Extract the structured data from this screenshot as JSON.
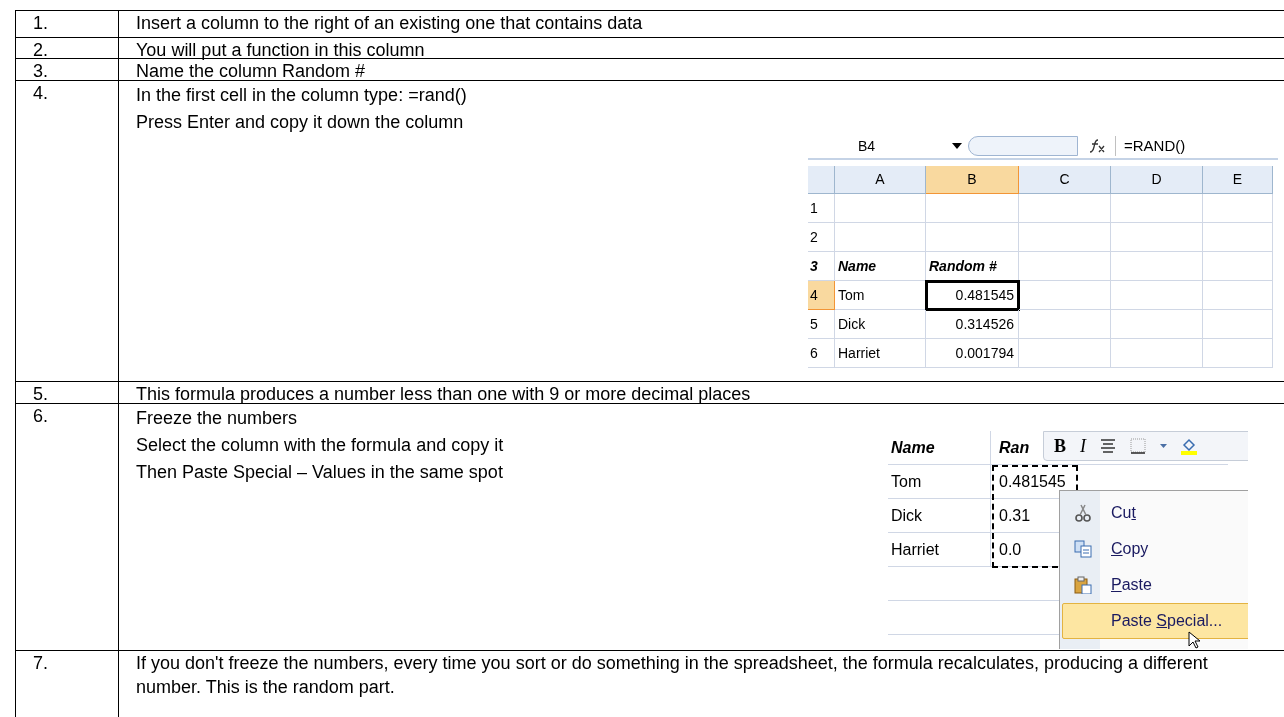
{
  "steps": [
    {
      "number": "1.",
      "lines": [
        "Insert a column to the right of an existing one that contains data"
      ]
    },
    {
      "number": "2.",
      "lines": [
        "You will put a function in this column"
      ]
    },
    {
      "number": "3.",
      "lines": [
        "Name the column Random #"
      ]
    },
    {
      "number": "4.",
      "lines": [
        "In the first cell in the column type: =rand()",
        "Press Enter and copy it down the column"
      ],
      "figure": {
        "kind": "sheet",
        "name_box": "B4",
        "formula": "=RAND()",
        "columns": [
          {
            "label": "A",
            "selected": false
          },
          {
            "label": "B",
            "selected": true
          },
          {
            "label": "C",
            "selected": false
          },
          {
            "label": "D",
            "selected": false
          },
          {
            "label": "E",
            "selected": false
          }
        ],
        "rows": [
          {
            "number": "1",
            "selected": false,
            "kind": "plain",
            "cells": []
          },
          {
            "number": "2",
            "selected": false,
            "kind": "plain",
            "cells": []
          },
          {
            "number": "3",
            "selected": false,
            "kind": "header",
            "cells": [
              "Name",
              "Random #"
            ]
          },
          {
            "number": "4",
            "selected": true,
            "kind": "plain",
            "cells": [
              "Tom",
              "0.481545"
            ]
          },
          {
            "number": "5",
            "selected": false,
            "kind": "plain",
            "cells": [
              "Dick",
              "0.314526"
            ]
          },
          {
            "number": "6",
            "selected": false,
            "kind": "plain",
            "cells": [
              "Harriet",
              "0.001794"
            ]
          }
        ]
      }
    },
    {
      "number": "5.",
      "lines": [
        "This formula produces a number less than one with 9 or more decimal places"
      ]
    },
    {
      "number": "6.",
      "lines": [
        "Freeze the numbers",
        "Select the column with the formula and copy it",
        "Then Paste Special – Values in the same spot"
      ],
      "figure": {
        "kind": "menu",
        "rows": [
          {
            "kind": "header",
            "cells": [
              "Name",
              "Ran"
            ]
          },
          {
            "kind": "plain",
            "cells": [
              "Tom",
              "0.481545"
            ]
          },
          {
            "kind": "plain",
            "cells": [
              "Dick",
              "0.31"
            ]
          },
          {
            "kind": "plain",
            "cells": [
              "Harriet",
              "0.0"
            ]
          }
        ],
        "toolbar": [
          "B",
          "I"
        ],
        "menu": [
          {
            "before": "Cu",
            "access_key": "t",
            "selected": false
          },
          {
            "access_key": "C",
            "after": "opy",
            "selected": false
          },
          {
            "access_key": "P",
            "after": "aste",
            "selected": false
          },
          {
            "before": "Paste ",
            "access_key": "S",
            "after": "pecial...",
            "selected": true
          }
        ]
      }
    },
    {
      "number": "7.",
      "lines": [
        "If you don't freeze the numbers, every time you sort or do something in the spreadsheet, the formula recalculates, producing a different number. This is the random part."
      ]
    }
  ]
}
